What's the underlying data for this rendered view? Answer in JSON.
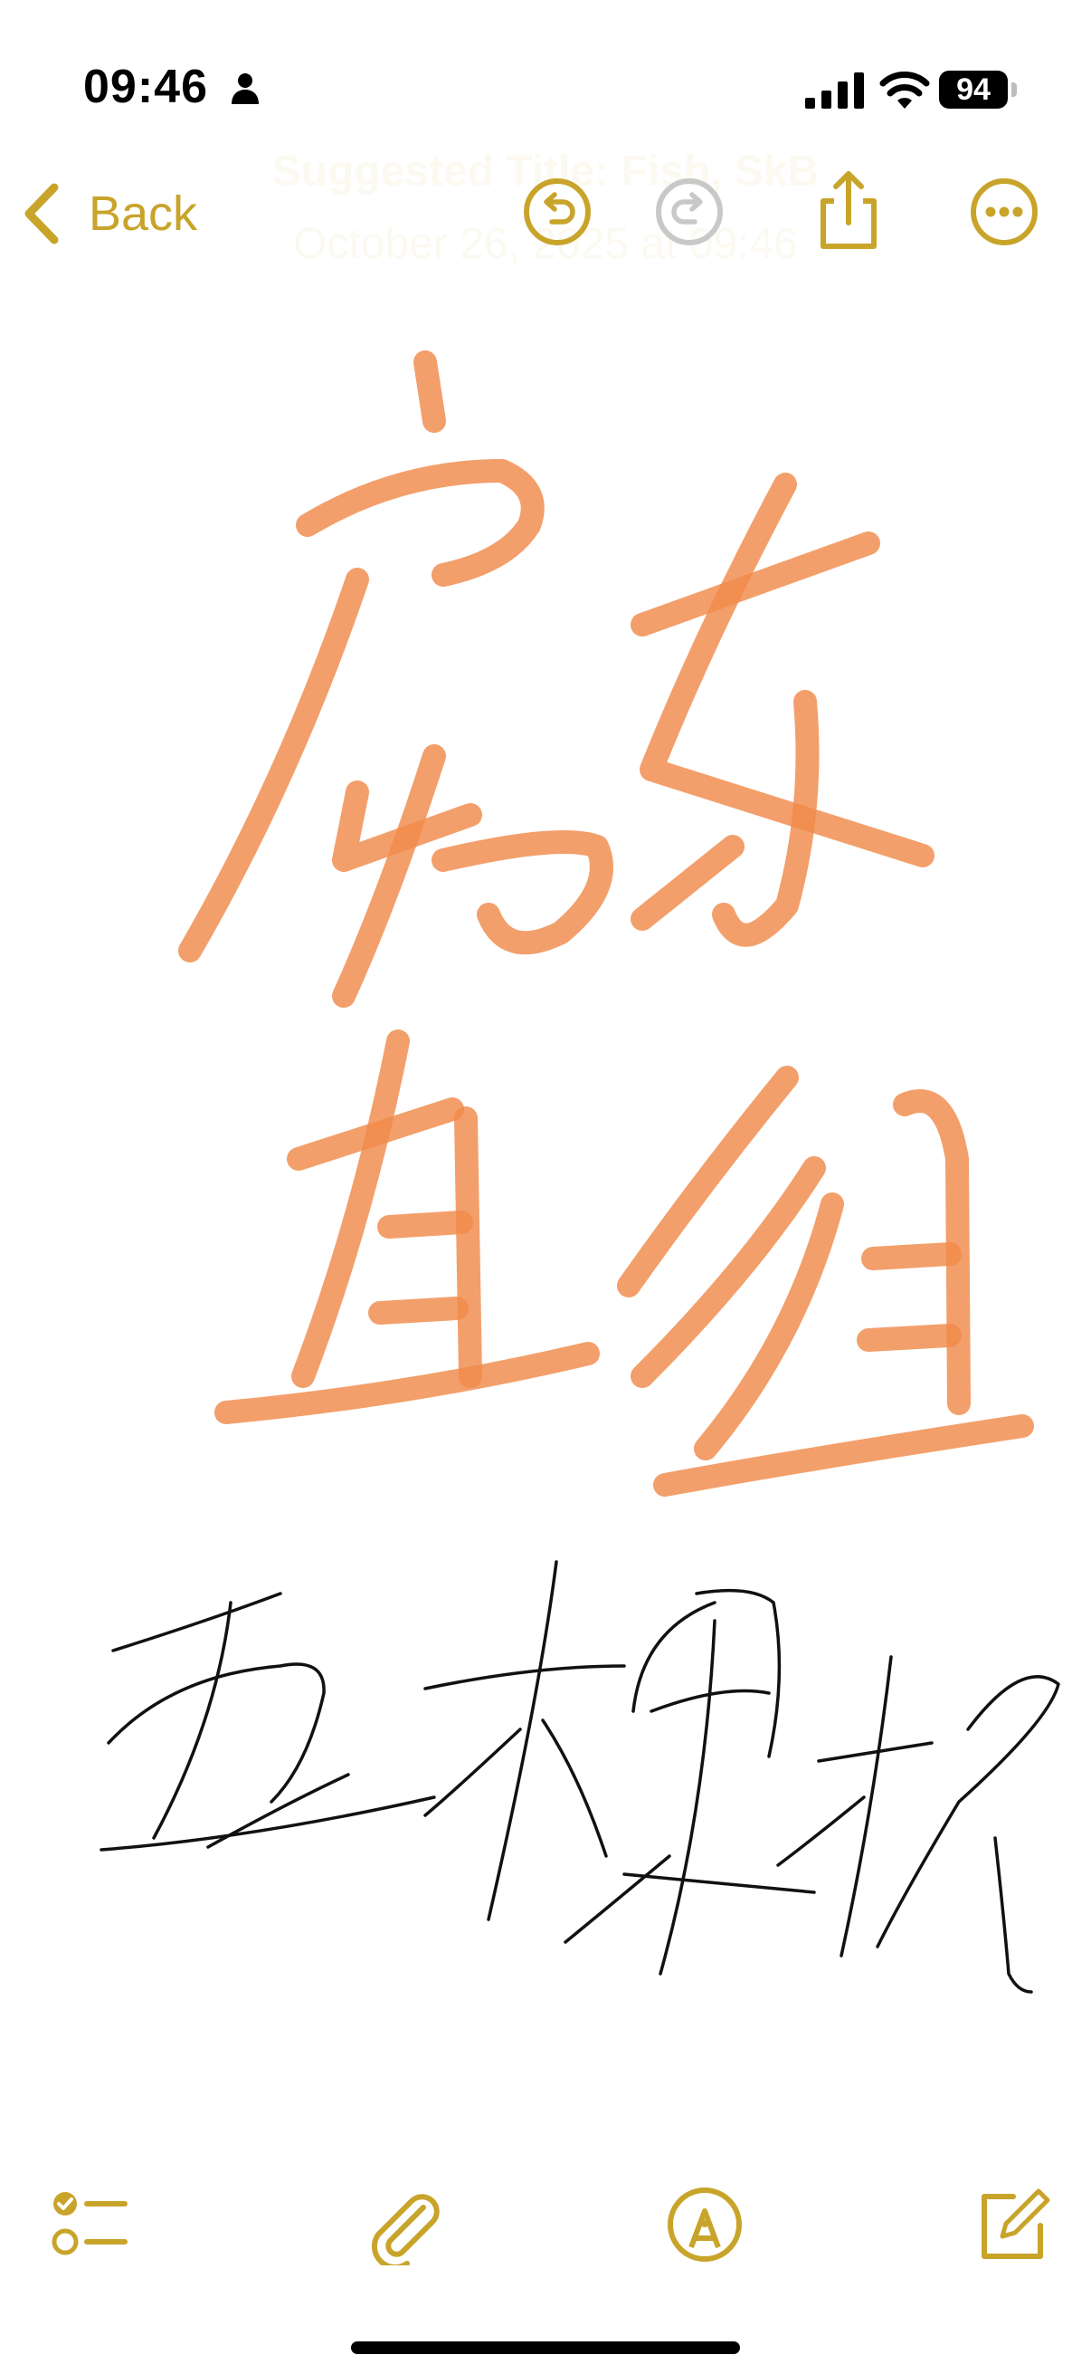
{
  "status_bar": {
    "time": "09:46",
    "battery_level": "94",
    "icons": [
      "person-icon",
      "cellular-signal-icon",
      "wifi-icon",
      "battery-icon"
    ]
  },
  "note": {
    "suggested_title": "Suggested Title: Fish, SkB",
    "date_line": "October 26, 2025 at 09:46"
  },
  "nav": {
    "back_label": "Back",
    "icons": [
      "chevron-left-icon",
      "undo-icon",
      "redo-icon",
      "share-icon",
      "more-icon"
    ]
  },
  "drawing": {
    "orange_ink_color": "#f08a4b",
    "black_ink_color": "#111111"
  },
  "toolbar": {
    "icons": [
      "checklist-icon",
      "paperclip-icon",
      "markup-pen-icon",
      "compose-icon"
    ]
  },
  "colors": {
    "accent": "#c8a42a",
    "disabled": "#c8c8c8"
  }
}
